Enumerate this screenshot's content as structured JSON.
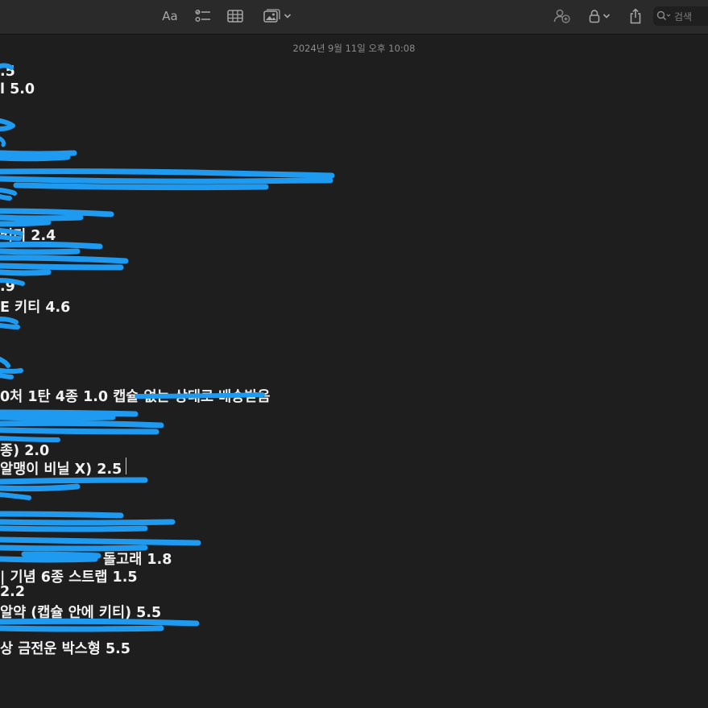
{
  "toolbar": {
    "format_label": "Aa",
    "search_placeholder": "검색"
  },
  "note": {
    "timestamp": "2024년 9월 11일 오후 10:08",
    "lines": [
      ".5",
      "l 5.0",
      "",
      "",
      "",
      "",
      "",
      "",
      "",
      "",
      "",
      "키티 2.4",
      "",
      "",
      "",
      ".9",
      "E 키티 4.6",
      "",
      "",
      "",
      "",
      "",
      "0처 1탄 4종 1.0 캡슐 없는 상태로 배송받음",
      "",
      "",
      "",
      "종) 2.0",
      "알맹이 비닐 X)  2.5",
      "",
      "",
      "",
      "",
      "돌고래 1.8",
      "| 기념 6종 스트랩 1.5",
      "2.2",
      "알약 (캡슐 안에 키티) 5.5",
      "",
      "상 금전운 박스형 5.5"
    ]
  },
  "colors": {
    "background": "#1e1e1e",
    "toolbar": "#2a2a2a",
    "scribble": "#1e9bf0"
  },
  "icons": [
    "format-text-icon",
    "checklist-icon",
    "table-icon",
    "media-icon",
    "chevron-down-icon",
    "collaborate-icon",
    "lock-icon",
    "share-icon",
    "search-icon"
  ]
}
